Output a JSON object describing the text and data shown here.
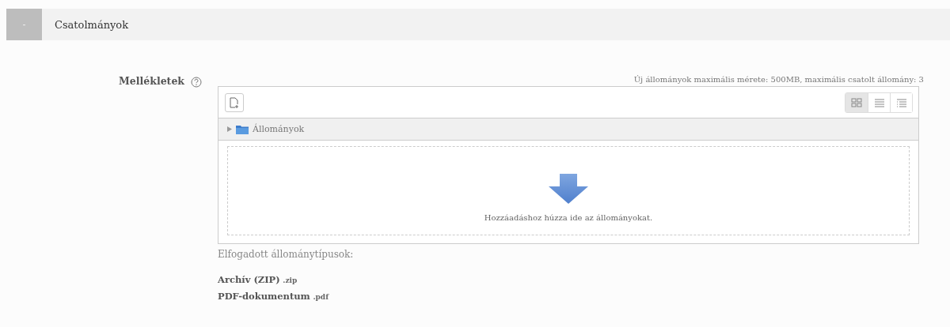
{
  "section": {
    "toggle": "-",
    "expanded": true,
    "title": "Csatolmányok"
  },
  "field": {
    "label": "Mellékletek",
    "limits": "Új állományok maximális mérete: 500MB, maximális csatolt állomány: 3",
    "views": [
      {
        "kind": "icons",
        "selected": true
      },
      {
        "kind": "list",
        "selected": false
      },
      {
        "kind": "tree",
        "selected": false
      }
    ],
    "path": "Állományok",
    "drop_text": "Hozzáadáshoz húzza ide az állományokat.",
    "accepted_heading": "Elfogadott állománytípusok:",
    "types": [
      {
        "name": "Archív (ZIP)",
        "ext": ".zip"
      },
      {
        "name": "PDF-dokumentum",
        "ext": ".pdf"
      }
    ]
  }
}
